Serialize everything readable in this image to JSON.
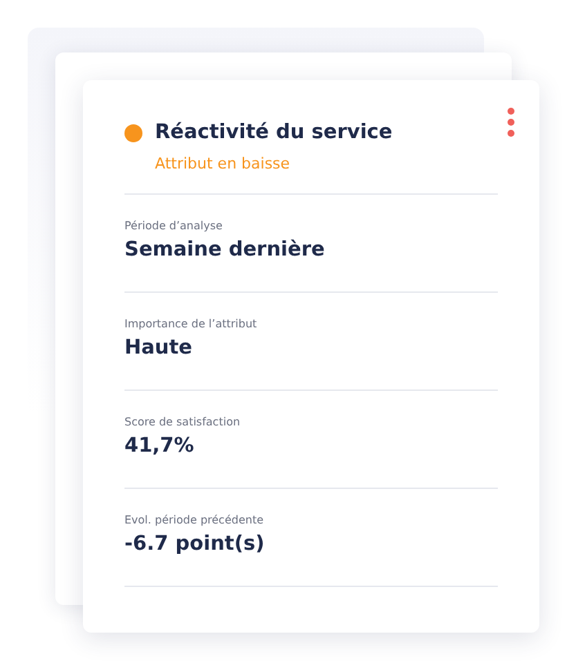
{
  "card": {
    "title": "Réactivité du service",
    "subtitle": "Attribut en baisse",
    "fields": [
      {
        "label": "Période d’analyse",
        "value": "Semaine dernière"
      },
      {
        "label": "Importance de l’attribut",
        "value": "Haute"
      },
      {
        "label": "Score de satisfaction",
        "value": "41,7%"
      },
      {
        "label": "Evol. période précédente",
        "value": "-6.7 point(s)"
      }
    ]
  }
}
